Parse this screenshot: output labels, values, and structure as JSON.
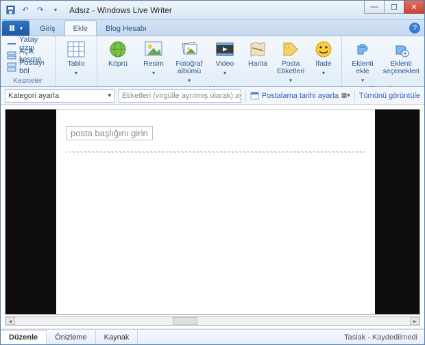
{
  "window": {
    "doc_title": "Adsız",
    "app_name": "Windows Live Writer"
  },
  "tabs": {
    "home": "Giriş",
    "insert": "Ekle",
    "blog": "Blog Hesabı"
  },
  "ribbon": {
    "kesmeler": {
      "hr": "Yatay çizgi",
      "clear": "Açık kesme",
      "split": "Postayı böl",
      "group": "Kesmeler"
    },
    "tablo": {
      "label": "Tablo",
      "group": ""
    },
    "medya": {
      "kopru": "Köprü",
      "resim": "Resim",
      "foto": "Fotoğraf albümü",
      "video": "Video",
      "harita": "Harita",
      "posta": "Posta Etiketleri",
      "ifade": "İfade",
      "group": "Medya"
    },
    "eklentiler": {
      "ekle": "Eklenti ekle",
      "secenek": "Eklenti seçenekleri",
      "group": "Eklentiler"
    }
  },
  "fieldbar": {
    "category": "Kategori ayarla",
    "tags_placeholder": "Etiketleri (virgülle ayrılmış olarak) ayarla",
    "schedule": "Postalama tarihi ayarla",
    "view_all": "Tümünü görüntüle"
  },
  "editor": {
    "title_placeholder": "posta başlığını girin"
  },
  "status": {
    "edit": "Düzenle",
    "preview": "Önizleme",
    "source": "Kaynak",
    "draft": "Taslak - Kaydedilmedi"
  }
}
